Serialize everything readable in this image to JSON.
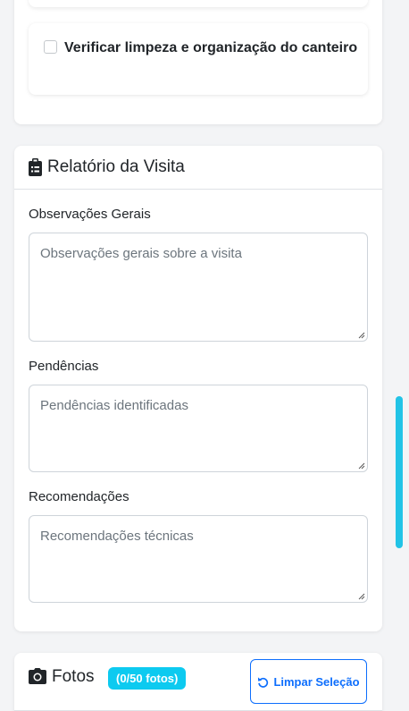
{
  "checklist": {
    "item_label": "Verificar limpeza e organização do canteiro",
    "item_checked": false
  },
  "report": {
    "title": "Relatório da Visita",
    "icon": "clipboard-icon",
    "fields": [
      {
        "label": "Observações Gerais",
        "placeholder": "Observações gerais sobre a visita",
        "value": ""
      },
      {
        "label": "Pendências",
        "placeholder": "Pendências identificadas",
        "value": ""
      },
      {
        "label": "Recomendações",
        "placeholder": "Recomendações técnicas",
        "value": ""
      }
    ]
  },
  "photos": {
    "title": "Fotos",
    "icon": "camera-icon",
    "badge": "(0/50 fotos)",
    "clear_button": "Limpar Seleção",
    "clear_icon": "undo-icon"
  },
  "colors": {
    "badge": "#0dcaf0",
    "primary": "#0d6efd",
    "scroll_thumb": "#22c3e6"
  }
}
